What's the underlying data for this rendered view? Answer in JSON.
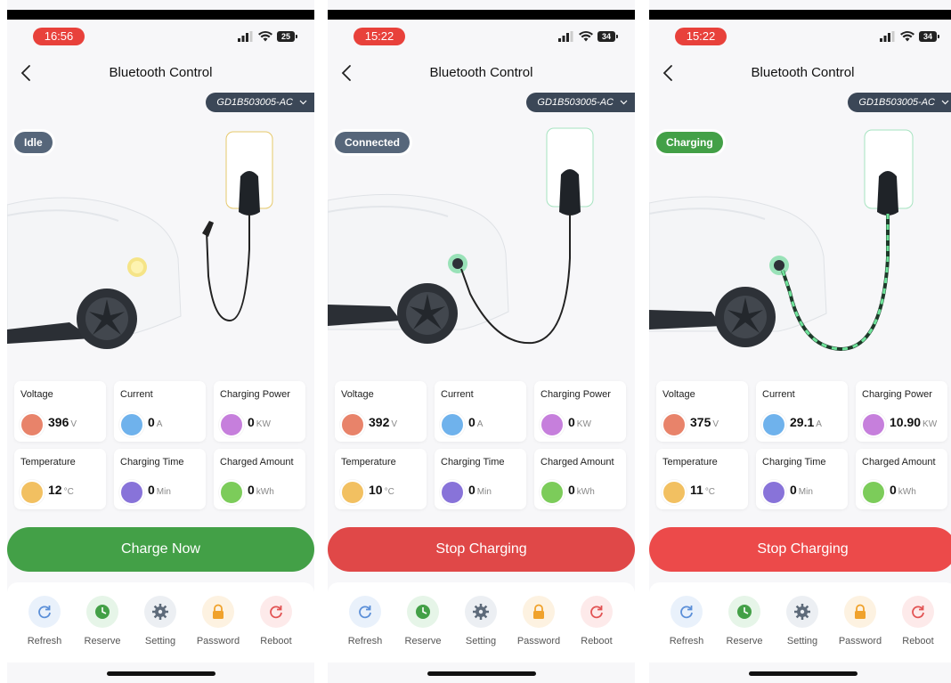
{
  "colors": {
    "idle": "#56667a",
    "connected": "#56667a",
    "charging": "#43a047",
    "green_button": "#43a047",
    "red_button": "#e04848",
    "voltage": "#e8836a",
    "current": "#6fb2ec",
    "power": "#c67fdc",
    "temperature": "#f2c061",
    "time": "#8873d9",
    "amount": "#7ccc5a"
  },
  "screens": [
    {
      "time": "16:56",
      "battery": "25",
      "nav_title": "Bluetooth Control",
      "device": "GD1B503005-AC",
      "status": "Idle",
      "status_color": "#56667a",
      "stats": {
        "voltage": {
          "label": "Voltage",
          "value": "396",
          "unit": "V"
        },
        "current": {
          "label": "Current",
          "value": "0",
          "unit": "A"
        },
        "power": {
          "label": "Charging Power",
          "value": "0",
          "unit": "KW"
        },
        "temperature": {
          "label": "Temperature",
          "value": "12",
          "unit": "°C"
        },
        "time": {
          "label": "Charging Time",
          "value": "0",
          "unit": "Min"
        },
        "amount": {
          "label": "Charged Amount",
          "value": "0",
          "unit": "kWh"
        }
      },
      "action": "Charge Now",
      "tools": [
        "Refresh",
        "Reserve",
        "Setting",
        "Password",
        "Reboot"
      ]
    },
    {
      "time": "15:22",
      "battery": "34",
      "nav_title": "Bluetooth Control",
      "device": "GD1B503005-AC",
      "status": "Connected",
      "status_color": "#56667a",
      "stats": {
        "voltage": {
          "label": "Voltage",
          "value": "392",
          "unit": "V"
        },
        "current": {
          "label": "Current",
          "value": "0",
          "unit": "A"
        },
        "power": {
          "label": "Charging Power",
          "value": "0",
          "unit": "KW"
        },
        "temperature": {
          "label": "Temperature",
          "value": "10",
          "unit": "°C"
        },
        "time": {
          "label": "Charging Time",
          "value": "0",
          "unit": "Min"
        },
        "amount": {
          "label": "Charged Amount",
          "value": "0",
          "unit": "kWh"
        }
      },
      "action": "Stop Charging",
      "tools": [
        "Refresh",
        "Reserve",
        "Setting",
        "Password",
        "Reboot"
      ]
    },
    {
      "time": "15:22",
      "battery": "34",
      "nav_title": "Bluetooth Control",
      "device": "GD1B503005-AC",
      "status": "Charging",
      "status_color": "#43a047",
      "stats": {
        "voltage": {
          "label": "Voltage",
          "value": "375",
          "unit": "V"
        },
        "current": {
          "label": "Current",
          "value": "29.1",
          "unit": "A"
        },
        "power": {
          "label": "Charging Power",
          "value": "10.90",
          "unit": "KW"
        },
        "temperature": {
          "label": "Temperature",
          "value": "11",
          "unit": "°C"
        },
        "time": {
          "label": "Charging Time",
          "value": "0",
          "unit": "Min"
        },
        "amount": {
          "label": "Charged Amount",
          "value": "0",
          "unit": "kWh"
        }
      },
      "action": "Stop Charging",
      "tools": [
        "Refresh",
        "Reserve",
        "Setting",
        "Password",
        "Reboot"
      ]
    }
  ]
}
